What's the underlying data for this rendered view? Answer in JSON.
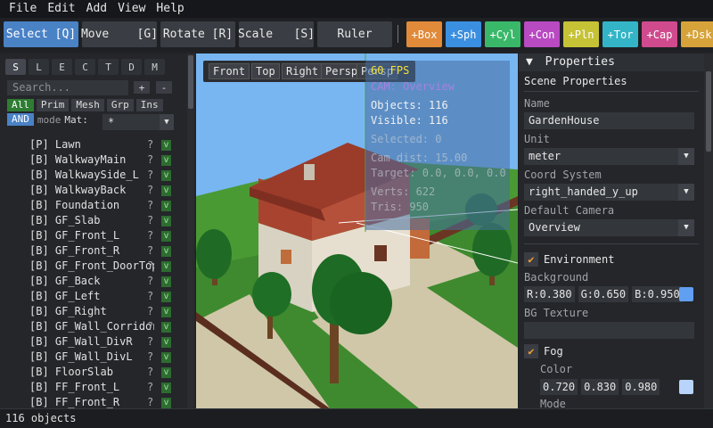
{
  "menu": [
    "File",
    "Edit",
    "Add",
    "View",
    "Help"
  ],
  "toolbar": {
    "tools": [
      "Select [Q]",
      "Move    [G]",
      "Rotate [R]",
      "Scale   [S]",
      "Ruler"
    ],
    "primitives": [
      {
        "label": "+Box",
        "color": "#e08a3a"
      },
      {
        "label": "+Sph",
        "color": "#3a8fe0"
      },
      {
        "label": "+Cyl",
        "color": "#3ab86a"
      },
      {
        "label": "+Con",
        "color": "#b84ac2"
      },
      {
        "label": "+Pln",
        "color": "#c6c236"
      },
      {
        "label": "+Tor",
        "color": "#33b5c7"
      },
      {
        "label": "+Cap",
        "color": "#d04a8e"
      },
      {
        "label": "+Dsk",
        "color": "#d6a23a"
      }
    ]
  },
  "left": {
    "tabs": [
      "S",
      "L",
      "E",
      "C",
      "T",
      "D",
      "M"
    ],
    "search_placeholder": "Search...",
    "add_label": "+",
    "remove_label": "-",
    "filters": [
      "All",
      "Prim",
      "Mesh",
      "Grp",
      "Ins"
    ],
    "and_label": "AND",
    "mode_label": "mode",
    "mat_label": "Mat:",
    "mat_value": "*",
    "objects": [
      {
        "name": "[P] Lawn"
      },
      {
        "name": "[B] WalkwayMain"
      },
      {
        "name": "[B] WalkwaySide_L"
      },
      {
        "name": "[B] WalkwayBack"
      },
      {
        "name": "[B] Foundation"
      },
      {
        "name": "[B] GF_Slab"
      },
      {
        "name": "[B] GF_Front_L"
      },
      {
        "name": "[B] GF_Front_R"
      },
      {
        "name": "[B] GF_Front_DoorTop"
      },
      {
        "name": "[B] GF_Back"
      },
      {
        "name": "[B] GF_Left"
      },
      {
        "name": "[B] GF_Right"
      },
      {
        "name": "[B] GF_Wall_Corridor"
      },
      {
        "name": "[B] GF_Wall_DivR"
      },
      {
        "name": "[B] GF_Wall_DivL"
      },
      {
        "name": "[B] FloorSlab"
      },
      {
        "name": "[B] FF_Front_L"
      },
      {
        "name": "[B] FF_Front_R"
      }
    ],
    "q_label": "?",
    "v_label": "v"
  },
  "viewport": {
    "tabs": [
      "Front",
      "Top",
      "Right",
      "Persp",
      "Persp"
    ],
    "fps": "60 FPS",
    "cam": "CAM: Overview",
    "objects": "Objects: 116",
    "visible": "Visible: 116",
    "selected": "Selected: 0",
    "camdist": "Cam dist: 15.00",
    "target": "Target: 0.0, 0.0, 0.0",
    "verts": "Verts: 622",
    "tris": "Tris: 950",
    "sky_color": "#78b6f2",
    "ground_color": "#3f8a2e"
  },
  "props": {
    "header": "Properties",
    "section": "Scene Properties",
    "name_label": "Name",
    "name_value": "GardenHouse",
    "unit_label": "Unit",
    "unit_value": "meter",
    "coord_label": "Coord System",
    "coord_value": "right_handed_y_up",
    "camera_label": "Default Camera",
    "camera_value": "Overview",
    "env_label": "Environment",
    "bg_label": "Background",
    "bg_r": "R:0.380",
    "bg_g": "G:0.650",
    "bg_b": "B:0.950",
    "bgtex_label": "BG Texture",
    "fog_label": "Fog",
    "color_label": "Color",
    "fog_r": "0.720",
    "fog_g": "0.830",
    "fog_b": "0.980",
    "mode_label": "Mode",
    "bg_swatch": "#619ff2",
    "fog_swatch": "#b8d4fa"
  },
  "status": "116 objects"
}
